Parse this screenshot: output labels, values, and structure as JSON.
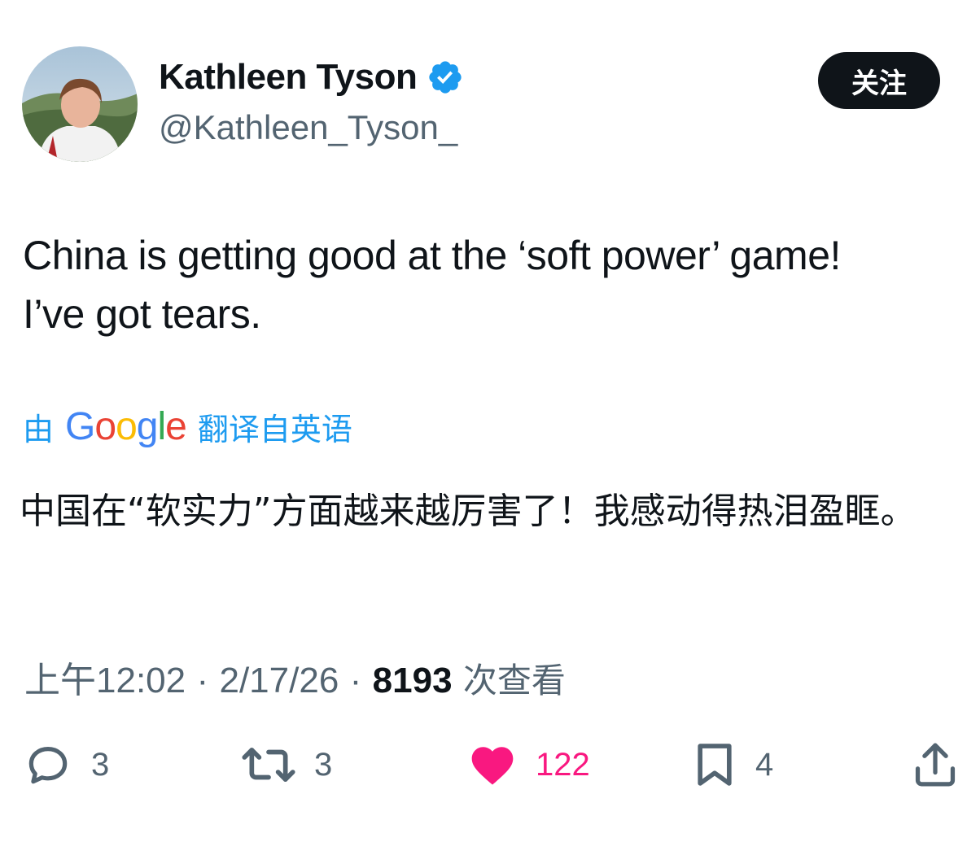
{
  "author": {
    "display_name": "Kathleen Tyson",
    "handle": "@Kathleen_Tyson_",
    "verified": true
  },
  "follow_button": {
    "label": "关注"
  },
  "tweet": {
    "text_line1": "China is getting good at the ‘soft power’ game!",
    "text_line2": "I’ve got tears."
  },
  "translation": {
    "prefix": "由",
    "provider": "Google",
    "suffix": "翻译自英语",
    "text": "中国在“软实力”方面越来越厉害了！我感动得热泪盈眶。"
  },
  "meta": {
    "time": "上午12:02",
    "separator": "·",
    "date": "2/17/26",
    "views_count": "8193",
    "views_label": "次查看"
  },
  "actions": {
    "reply_count": "3",
    "retweet_count": "3",
    "like_count": "122",
    "bookmark_count": "4"
  },
  "colors": {
    "accent": "#1d9bf0",
    "like": "#f91880",
    "muted": "#536471",
    "text": "#0f1419"
  }
}
